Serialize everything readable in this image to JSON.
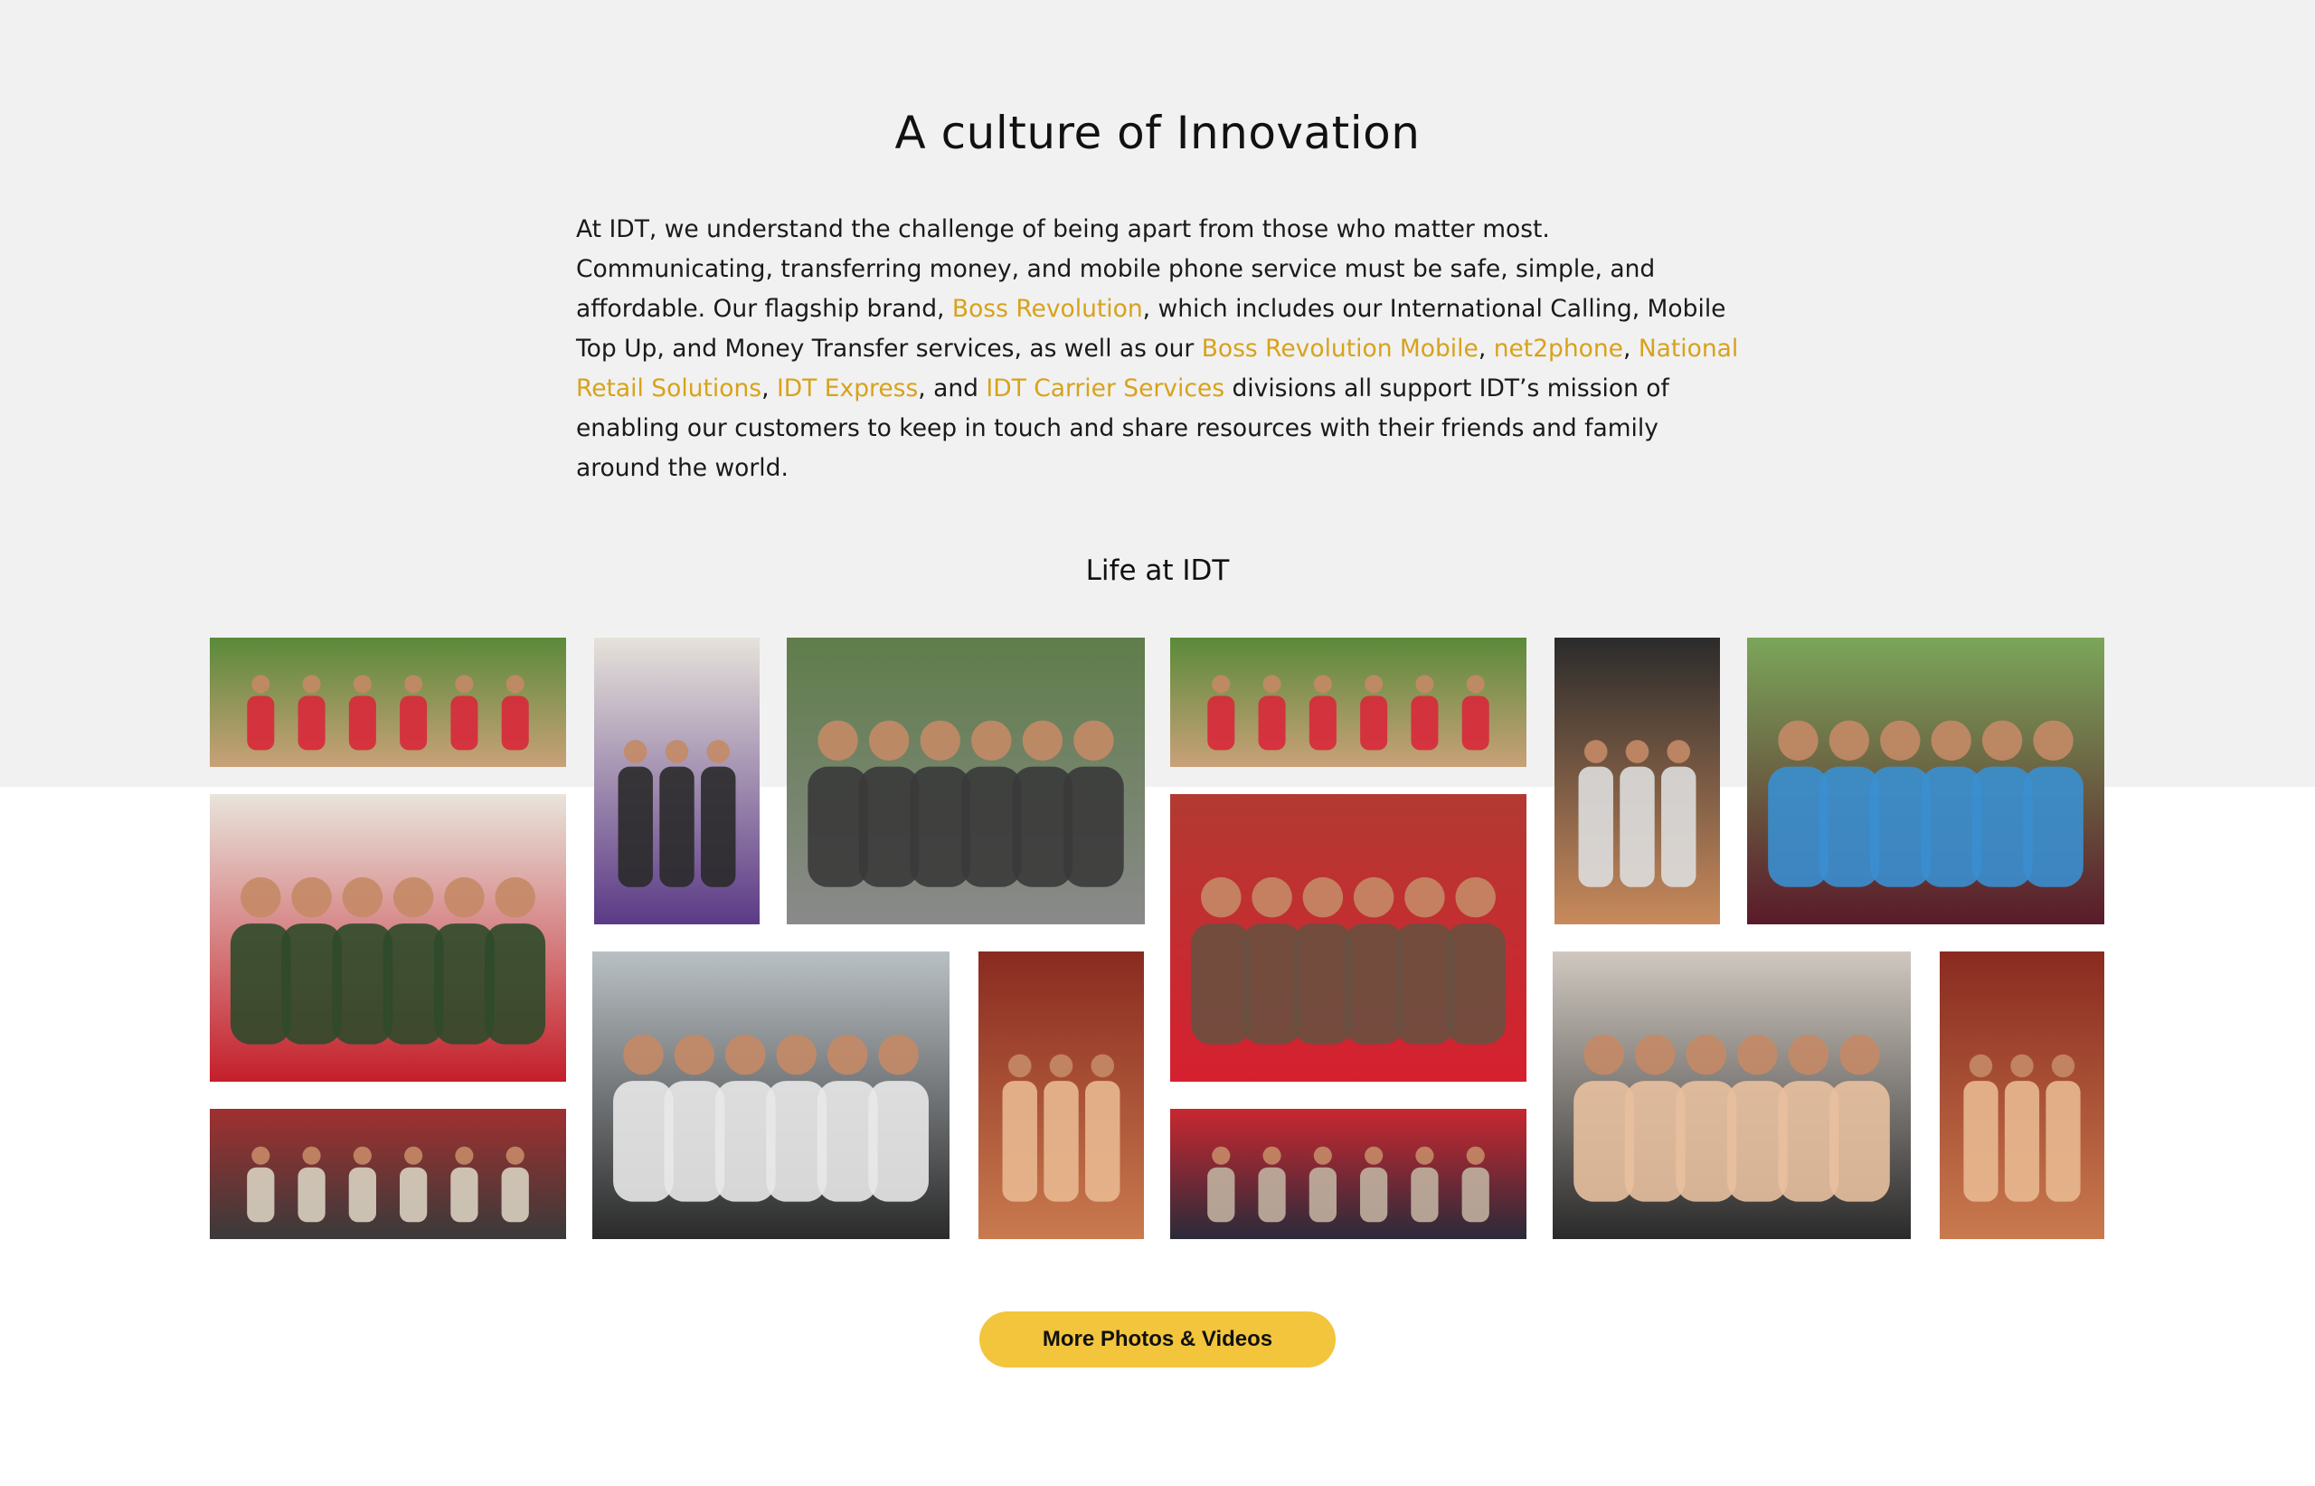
{
  "section": {
    "title": "A culture of Innovation",
    "intro": {
      "p1": "At IDT, we understand the challenge of being apart from those who matter most. Communicating, transferring money, and mobile phone service must be safe, simple, and affordable. Our flagship brand, ",
      "link_boss_revolution": "Boss Revolution",
      "p2": ", which includes our International Calling, Mobile Top Up, and Money Transfer services, as well as our ",
      "link_boss_revolution_mobile": "Boss Revolution Mobile",
      "sep1": ", ",
      "link_net2phone": "net2phone",
      "sep2": ", ",
      "link_nrs": "National Retail Solutions",
      "sep3": ", ",
      "link_idt_express": "IDT Express",
      "sep4": ", and ",
      "link_idt_carrier": "IDT Carrier Services",
      "p3": " divisions all support IDT’s mission of enabling our customers to keep in touch and share resources with their friends and family around the world."
    },
    "link_color": "#d8a21a"
  },
  "gallery": {
    "title": "Life at IDT",
    "photos": [
      {
        "name": "softball-team-photo",
        "palette": [
          "#5a8a3a",
          "#c9a178",
          "#d8283a"
        ]
      },
      {
        "name": "costume-hallway-photo",
        "palette": [
          "#e6e2da",
          "#5b3a86",
          "#2a2a2a"
        ]
      },
      {
        "name": "rooftop-group-photo",
        "palette": [
          "#5f7d4a",
          "#8a8a8a",
          "#3a3a3a"
        ]
      },
      {
        "name": "softball-team-photo-2",
        "palette": [
          "#5a8a3a",
          "#c9a178",
          "#d8283a"
        ]
      },
      {
        "name": "headphones-portrait-photo",
        "palette": [
          "#2b2b2b",
          "#c98a5c",
          "#dddddd"
        ]
      },
      {
        "name": "party-group-photo",
        "palette": [
          "#7ba65a",
          "#5a1a2a",
          "#3a8fd0"
        ]
      },
      {
        "name": "office-red-booth-photo",
        "palette": [
          "#e8e4dc",
          "#c41f2a",
          "#2f4a2a"
        ]
      },
      {
        "name": "laptop-discussion-photo",
        "palette": [
          "#b9c0c4",
          "#2a2a2a",
          "#e8e8e8"
        ]
      },
      {
        "name": "dancing-friends-photo",
        "palette": [
          "#8a2a20",
          "#c97a4e",
          "#e8b890"
        ]
      },
      {
        "name": "team-red-shirts-photo",
        "palette": [
          "#b23a32",
          "#d62030",
          "#6a5040"
        ]
      },
      {
        "name": "hackathon-selfie-photo",
        "palette": [
          "#d0c8c0",
          "#2a2a2a",
          "#e8c0a0"
        ]
      },
      {
        "name": "dancing-friends-photo-2",
        "palette": [
          "#8a2a20",
          "#c97a4e",
          "#e8b890"
        ]
      },
      {
        "name": "chess-match-photo",
        "palette": [
          "#a03030",
          "#3a3a3a",
          "#d8d0c0"
        ]
      },
      {
        "name": "event-group-photo",
        "palette": [
          "#c82830",
          "#2a2a3a",
          "#c0b0a0"
        ]
      }
    ]
  },
  "cta": {
    "label": "More Photos & Videos",
    "color": "#f2c53d"
  }
}
